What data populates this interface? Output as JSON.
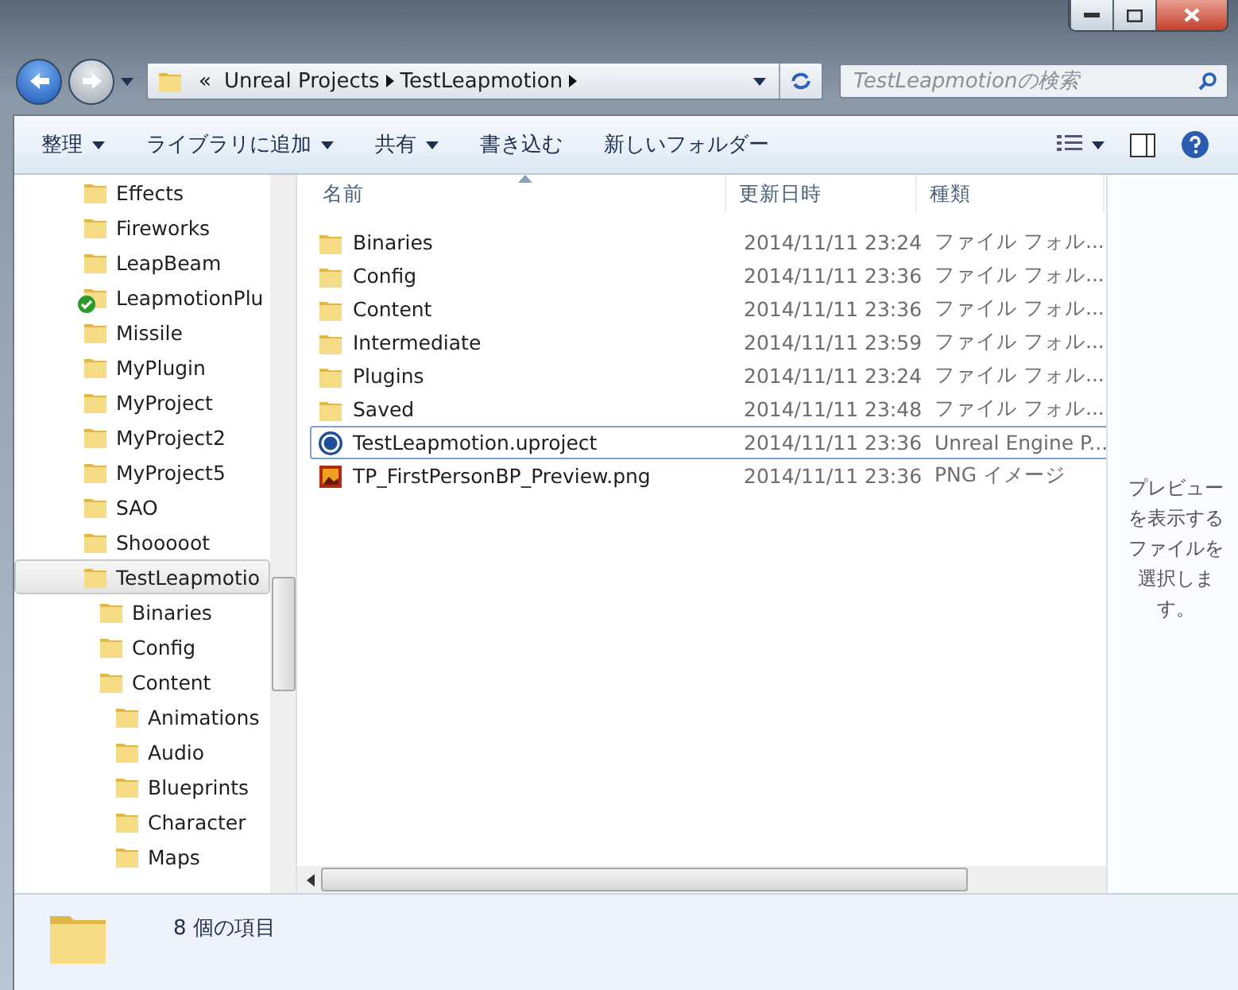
{
  "address_bar": {
    "overflow": "«",
    "crumbs": [
      "Unreal Projects",
      "TestLeapmotion"
    ]
  },
  "search": {
    "placeholder": "TestLeapmotionの検索"
  },
  "toolbar": {
    "buttons": [
      {
        "label": "整理",
        "dropdown": true
      },
      {
        "label": "ライブラリに追加",
        "dropdown": true
      },
      {
        "label": "共有",
        "dropdown": true
      },
      {
        "label": "書き込む",
        "dropdown": false
      },
      {
        "label": "新しいフォルダー",
        "dropdown": false
      }
    ]
  },
  "sidebar": {
    "items": [
      {
        "label": "Effects",
        "selected": false,
        "synced": false
      },
      {
        "label": "Fireworks",
        "selected": false,
        "synced": false
      },
      {
        "label": "LeapBeam",
        "selected": false,
        "synced": false
      },
      {
        "label": "LeapmotionPlu",
        "selected": false,
        "synced": true
      },
      {
        "label": "Missile",
        "selected": false,
        "synced": false
      },
      {
        "label": "MyPlugin",
        "selected": false,
        "synced": false
      },
      {
        "label": "MyProject",
        "selected": false,
        "synced": false
      },
      {
        "label": "MyProject2",
        "selected": false,
        "synced": false
      },
      {
        "label": "MyProject5",
        "selected": false,
        "synced": false
      },
      {
        "label": "SAO",
        "selected": false,
        "synced": false
      },
      {
        "label": "Shooooot",
        "selected": false,
        "synced": false
      },
      {
        "label": "TestLeapmotio",
        "selected": true,
        "synced": false,
        "children": [
          {
            "label": "Binaries",
            "selected": false,
            "synced": false
          },
          {
            "label": "Config",
            "selected": false,
            "synced": false
          },
          {
            "label": "Content",
            "selected": false,
            "synced": false,
            "children": [
              {
                "label": "Animations",
                "selected": false,
                "synced": false
              },
              {
                "label": "Audio",
                "selected": false,
                "synced": false
              },
              {
                "label": "Blueprints",
                "selected": false,
                "synced": false
              },
              {
                "label": "Character",
                "selected": false,
                "synced": false
              },
              {
                "label": "Maps",
                "selected": false,
                "synced": false
              }
            ]
          }
        ]
      }
    ]
  },
  "file_list": {
    "columns": [
      {
        "label": "名前",
        "sorted": true
      },
      {
        "label": "更新日時",
        "sorted": false
      },
      {
        "label": "種類",
        "sorted": false
      }
    ],
    "rows": [
      {
        "kind": "folder",
        "name": "Binaries",
        "modified": "2014/11/11 23:24",
        "type": "ファイル フォル...",
        "focused": false
      },
      {
        "kind": "folder",
        "name": "Config",
        "modified": "2014/11/11 23:36",
        "type": "ファイル フォル...",
        "focused": false
      },
      {
        "kind": "folder",
        "name": "Content",
        "modified": "2014/11/11 23:36",
        "type": "ファイル フォル...",
        "focused": false
      },
      {
        "kind": "folder",
        "name": "Intermediate",
        "modified": "2014/11/11 23:59",
        "type": "ファイル フォル...",
        "focused": false
      },
      {
        "kind": "folder",
        "name": "Plugins",
        "modified": "2014/11/11 23:24",
        "type": "ファイル フォル...",
        "focused": false
      },
      {
        "kind": "folder",
        "name": "Saved",
        "modified": "2014/11/11 23:48",
        "type": "ファイル フォル...",
        "focused": false
      },
      {
        "kind": "uproject",
        "name": "TestLeapmotion.uproject",
        "modified": "2014/11/11 23:36",
        "type": "Unreal Engine P...",
        "focused": true
      },
      {
        "kind": "image",
        "name": "TP_FirstPersonBP_Preview.png",
        "modified": "2014/11/11 23:36",
        "type": "PNG イメージ",
        "focused": false
      }
    ]
  },
  "preview_pane": {
    "message": "プレビューを表示するファイルを選択します。"
  },
  "status_bar": {
    "count": "8 個の項目"
  }
}
